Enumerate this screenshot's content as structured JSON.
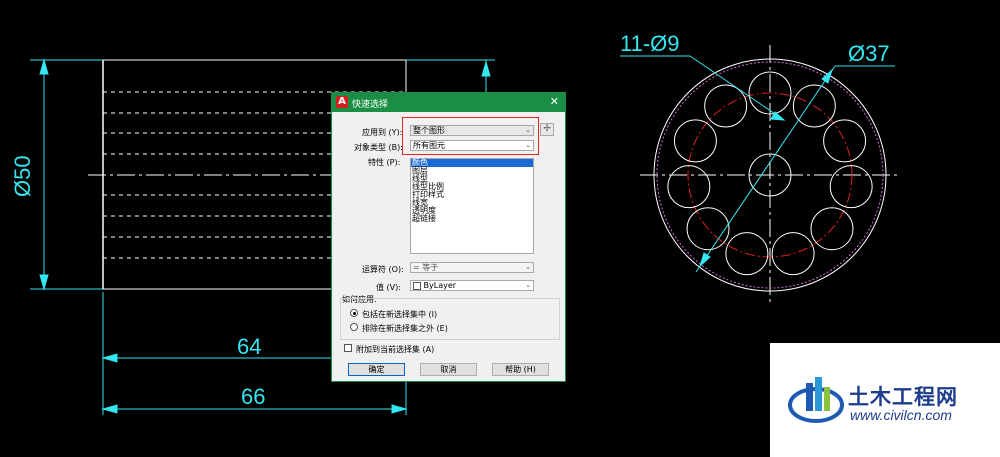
{
  "drawing": {
    "dim_diameter_50": "Ø50",
    "dim_length_64": "64",
    "dim_length_66": "66",
    "dim_holes": "11-Ø9",
    "dim_diameter_37": "Ø37"
  },
  "dialog": {
    "app_icon": "A",
    "title": "快速选择",
    "close_symbol": "✕",
    "apply_to_label": "应用到 (Y):",
    "apply_to_value": "整个图形",
    "object_type_label": "对象类型 (B):",
    "object_type_value": "所有图元",
    "properties_label": "特性 (P):",
    "properties": [
      "颜色",
      "图层",
      "线型",
      "线型比例",
      "打印样式",
      "线宽",
      "透明度",
      "超链接"
    ],
    "selected_property": "颜色",
    "operator_label": "运算符 (O):",
    "operator_value": "= 等于",
    "value_label": "值 (V):",
    "value_value": "ByLayer",
    "how_to_apply_label": "如何应用:",
    "include_option": "包括在新选择集中 (I)",
    "exclude_option": "排除在新选择集之外 (E)",
    "append_label": "附加到当前选择集 (A)",
    "ok_button": "确定",
    "cancel_button": "取消",
    "help_button": "帮助 (H)"
  },
  "watermark": {
    "title": "土木工程网",
    "url": "www.civilcn.com"
  },
  "colors": {
    "background": "#000000",
    "dimension": "#33e6f0",
    "geometry": "#ffffff",
    "circle_outer": "#d070d0",
    "center_line": "#e02020",
    "dialog_title": "#1a8f44",
    "highlight": "#e02828"
  }
}
